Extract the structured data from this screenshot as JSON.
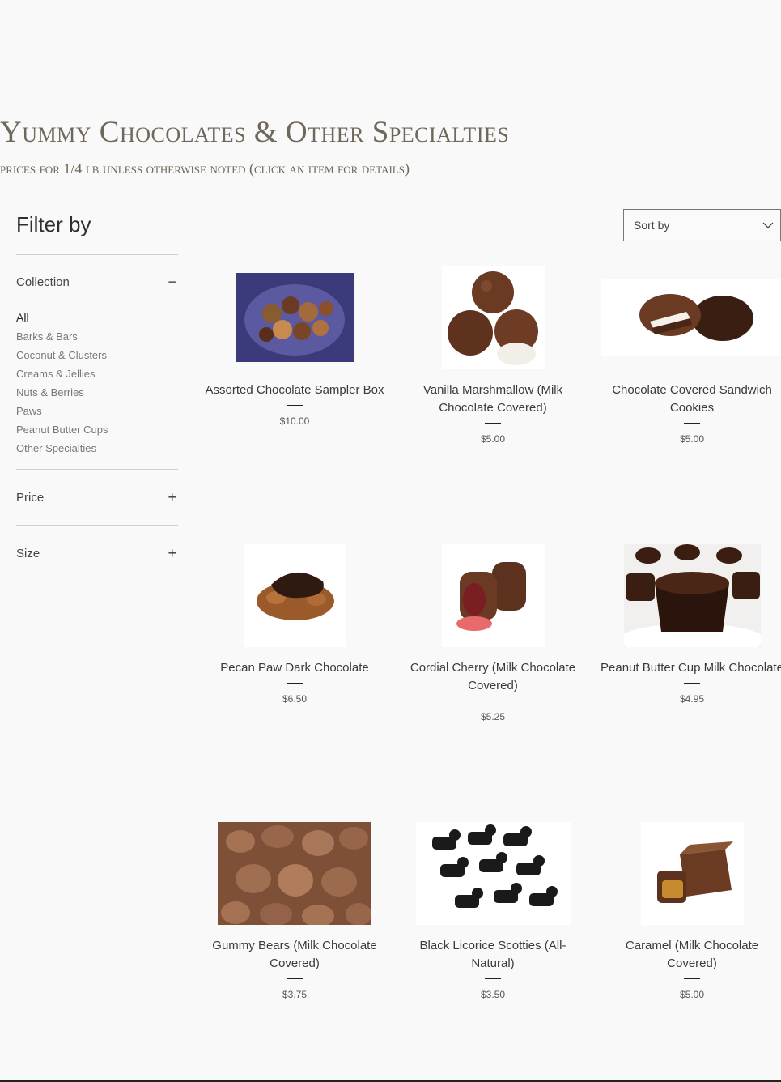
{
  "header": {
    "title": "Yummy Chocolates & Other Specialties",
    "subtitle": "prices for 1/4 lb unless otherwise noted (click an item for details)"
  },
  "filter": {
    "title": "Filter by",
    "collection": {
      "label": "Collection",
      "toggle": "−",
      "items": [
        "All",
        "Barks & Bars",
        "Coconut & Clusters",
        "Creams & Jellies",
        "Nuts & Berries",
        "Paws",
        "Peanut Butter Cups",
        "Other Specialties"
      ],
      "selected": "All"
    },
    "price": {
      "label": "Price",
      "toggle": "+"
    },
    "size": {
      "label": "Size",
      "toggle": "+"
    }
  },
  "sort": {
    "label": "Sort by",
    "icon": "chevron-down-icon"
  },
  "products": [
    {
      "name": "Assorted Chocolate Sampler Box",
      "price": "$10.00"
    },
    {
      "name": "Vanilla Marshmallow (Milk Chocolate Covered)",
      "price": "$5.00"
    },
    {
      "name": "Chocolate Covered Sandwich Cookies",
      "price": "$5.00"
    },
    {
      "name": "Pecan Paw Dark Chocolate",
      "price": "$6.50"
    },
    {
      "name": "Cordial Cherry (Milk Chocolate Covered)",
      "price": "$5.25"
    },
    {
      "name": "Peanut Butter Cup Milk Chocolate",
      "price": "$4.95"
    },
    {
      "name": "Gummy Bears (Milk Chocolate Covered)",
      "price": "$3.75"
    },
    {
      "name": "Black Licorice Scotties (All-Natural)",
      "price": "$3.50"
    },
    {
      "name": "Caramel (Milk Chocolate Covered)",
      "price": "$5.00"
    }
  ],
  "colors": {
    "title": "#6f6759",
    "text": "#333333",
    "background": "#f9f9f9",
    "chocolate": "#6b3a22"
  }
}
